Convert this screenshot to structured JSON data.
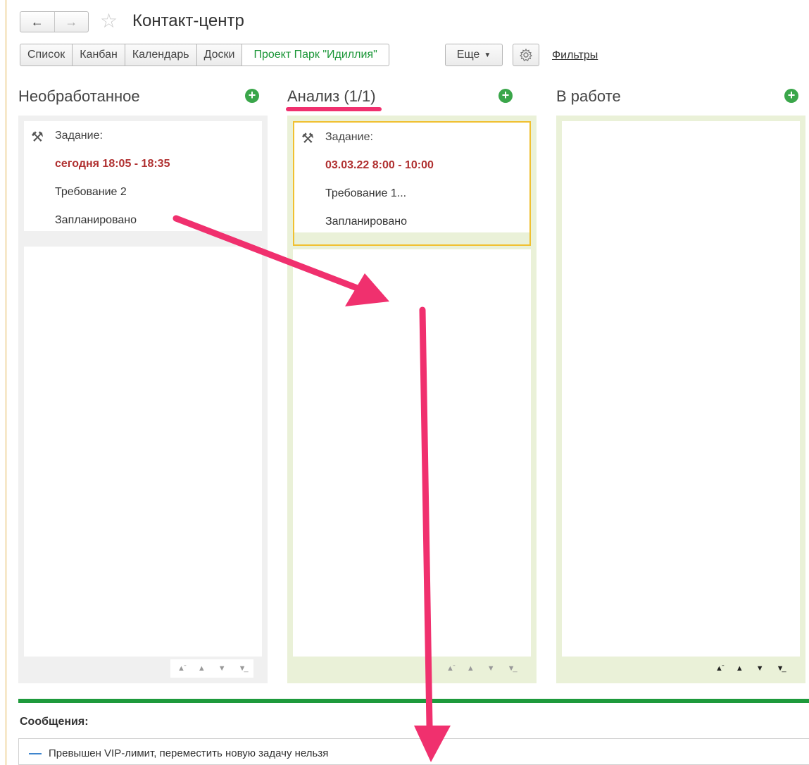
{
  "header": {
    "title": "Контакт-центр",
    "nav_back_icon": "arrow-left-icon",
    "nav_forward_icon": "arrow-right-icon",
    "favorite_icon": "star-icon"
  },
  "toolbar": {
    "tabs": [
      {
        "label": "Список"
      },
      {
        "label": "Канбан"
      },
      {
        "label": "Календарь"
      },
      {
        "label": "Доски"
      },
      {
        "label": "Проект Парк \"Идиллия\""
      }
    ],
    "more_label": "Еще",
    "settings_icon": "gear-icon",
    "filters_label": "Фильтры"
  },
  "columns": [
    {
      "title": "Необработанное",
      "cards": [
        {
          "type": "Задание:",
          "date": "сегодня 18:05 - 18:35",
          "name": "Требование 2",
          "status": "Запланировано"
        }
      ]
    },
    {
      "title": "Анализ (1/1)",
      "cards": [
        {
          "type": "Задание:",
          "date": "03.03.22 8:00 - 10:00",
          "name": "Требование 1...",
          "status": "Запланировано"
        }
      ]
    },
    {
      "title": "В работе",
      "cards": []
    }
  ],
  "messages": {
    "title": "Сообщения:",
    "items": [
      {
        "text": "Превышен VIP-лимит, переместить новую задачу нельзя"
      }
    ]
  },
  "colors": {
    "accent_green": "#1e9a3c",
    "annotation_pink": "#f0306e",
    "date_red": "#b03030",
    "selected_border": "#f0c030"
  }
}
